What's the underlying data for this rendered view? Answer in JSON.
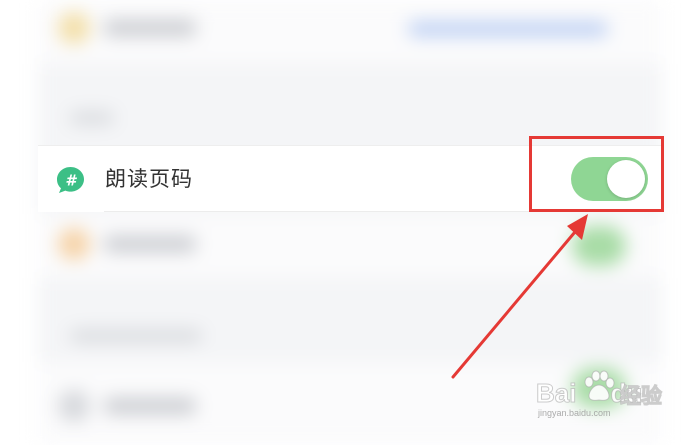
{
  "setting": {
    "label": "朗读页码",
    "enabled": true,
    "icon": "hash-speech-bubble-icon"
  },
  "colors": {
    "toggle_on": "#8fd694",
    "icon_green": "#3cbf86",
    "annotation_red": "#e53935"
  },
  "watermark": {
    "brand": "Bai",
    "brand_suffix": "du",
    "product": "经验",
    "url": "jingyan.baidu.com"
  }
}
